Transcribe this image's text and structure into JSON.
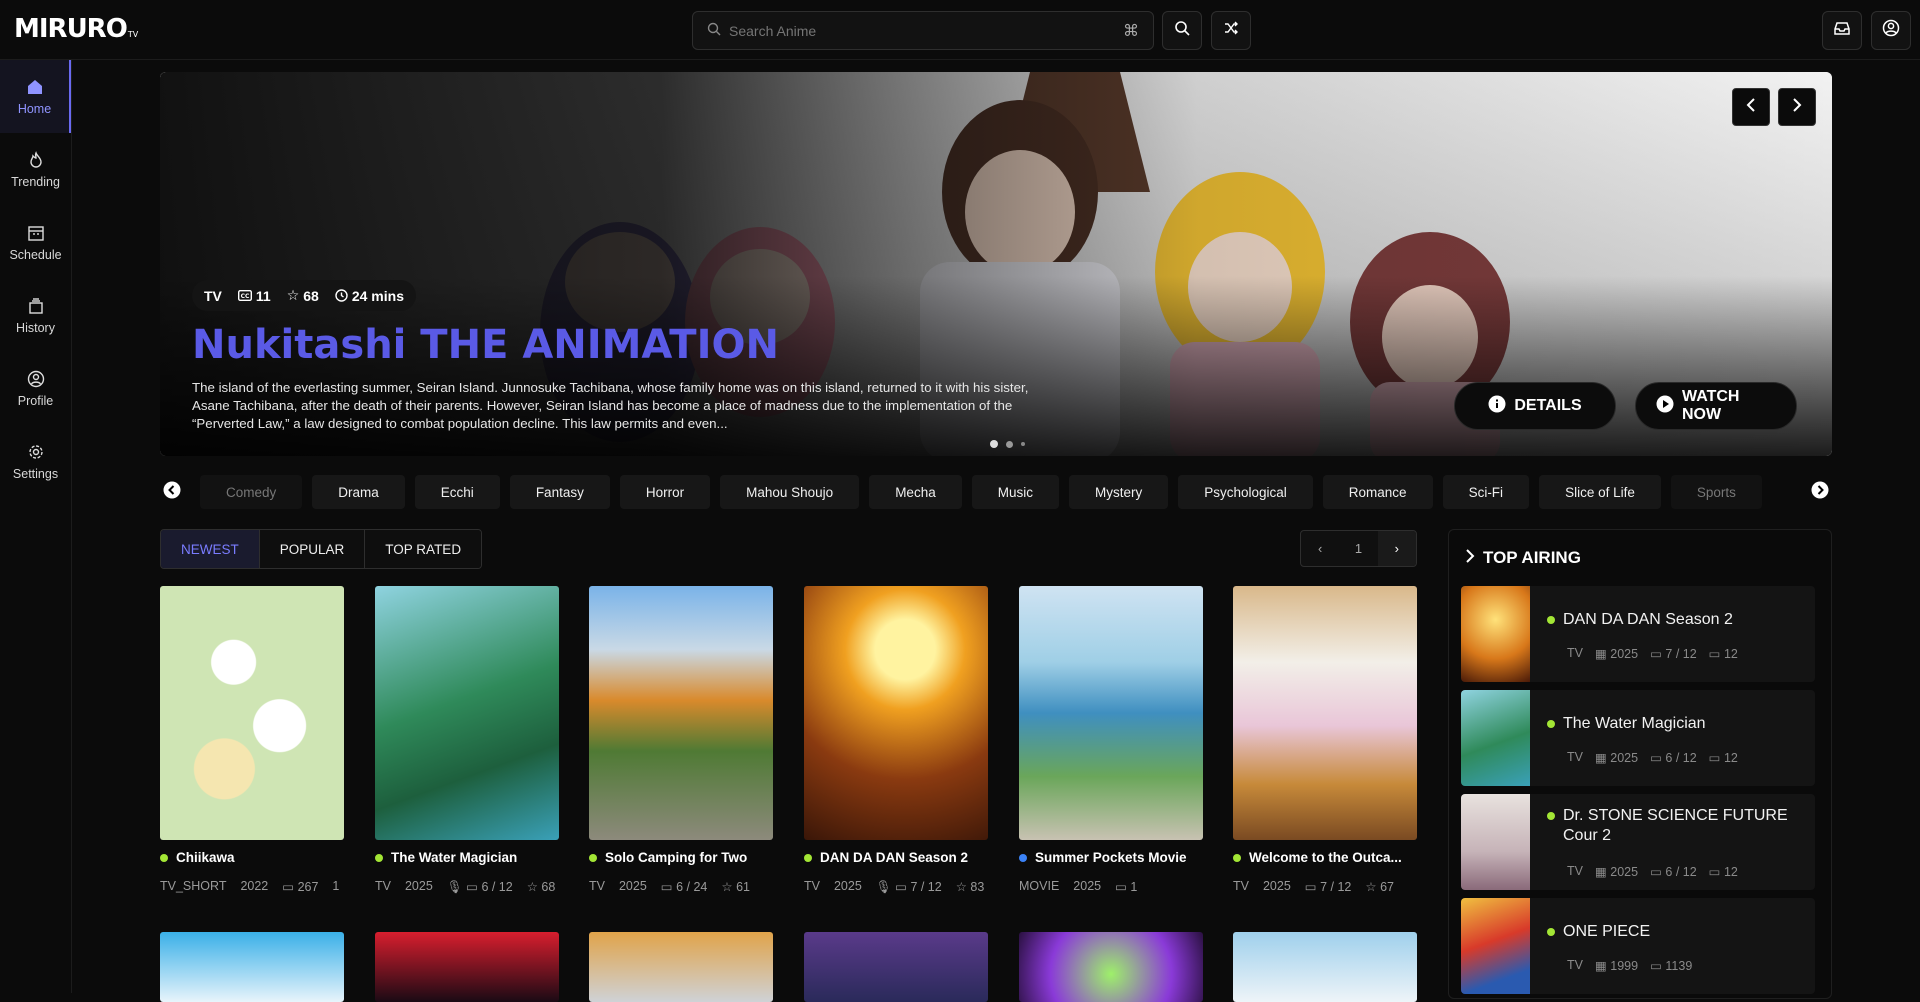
{
  "app": {
    "logo": "MIRURO",
    "logo_suffix": "TV"
  },
  "search": {
    "placeholder": "Search Anime",
    "shortcut_icon": "command-icon"
  },
  "sidebar": {
    "items": [
      {
        "label": "Home",
        "icon": "home-icon"
      },
      {
        "label": "Trending",
        "icon": "flame-icon"
      },
      {
        "label": "Schedule",
        "icon": "calendar-icon"
      },
      {
        "label": "History",
        "icon": "history-icon"
      },
      {
        "label": "Profile",
        "icon": "user-icon"
      },
      {
        "label": "Settings",
        "icon": "gear-icon"
      }
    ]
  },
  "hero": {
    "type": "TV",
    "episodes": "11",
    "rating": "68",
    "duration": "24 mins",
    "title": "Nukitashi THE ANIMATION",
    "description": "The island of the everlasting summer, Seiran Island. Junnosuke Tachibana, whose family home was on this island, returned to it with his sister, Asane Tachibana, after the death of their parents. However, Seiran Island has become a place of madness due to the implementation of the “Perverted Law,” a law designed to combat population decline. This law permits and even...",
    "details_label": "DETAILS",
    "watch_label": "WATCH NOW",
    "slide_count": 3,
    "active_slide": 1
  },
  "genres": [
    "Comedy",
    "Drama",
    "Ecchi",
    "Fantasy",
    "Horror",
    "Mahou Shoujo",
    "Mecha",
    "Music",
    "Mystery",
    "Psychological",
    "Romance",
    "Sci-Fi",
    "Slice of Life",
    "Sports"
  ],
  "tabs": [
    "NEWEST",
    "POPULAR",
    "TOP RATED"
  ],
  "pager": {
    "page": "1"
  },
  "cards": [
    {
      "title": "Chiikawa",
      "status": "green",
      "type": "TV_SHORT",
      "year": "2022",
      "eps": "267",
      "extra": "1"
    },
    {
      "title": "The Water Magician",
      "status": "green",
      "type": "TV",
      "year": "2025",
      "eps": "6 / 12",
      "extra": "68"
    },
    {
      "title": "Solo Camping for Two",
      "status": "green",
      "type": "TV",
      "year": "2025",
      "eps": "6 / 24",
      "extra": "61"
    },
    {
      "title": "DAN DA DAN Season 2",
      "status": "green",
      "type": "TV",
      "year": "2025",
      "eps": "7 / 12",
      "extra": "83"
    },
    {
      "title": "Summer Pockets Movie",
      "status": "blue",
      "type": "MOVIE",
      "year": "2025",
      "eps": "1",
      "extra": ""
    },
    {
      "title": "Welcome to the Outca...",
      "status": "green",
      "type": "TV",
      "year": "2025",
      "eps": "7 / 12",
      "extra": "67"
    }
  ],
  "top_airing": {
    "heading": "TOP AIRING",
    "items": [
      {
        "title": "DAN DA DAN Season 2",
        "type": "TV",
        "year": "2025",
        "eps": "7 / 12",
        "total": "12"
      },
      {
        "title": "The Water Magician",
        "type": "TV",
        "year": "2025",
        "eps": "6 / 12",
        "total": "12"
      },
      {
        "title": "Dr. STONE SCIENCE FUTURE Cour 2",
        "type": "TV",
        "year": "2025",
        "eps": "6 / 12",
        "total": "12"
      },
      {
        "title": "ONE PIECE",
        "type": "TV",
        "year": "1999",
        "eps": "1139",
        "total": ""
      }
    ]
  }
}
